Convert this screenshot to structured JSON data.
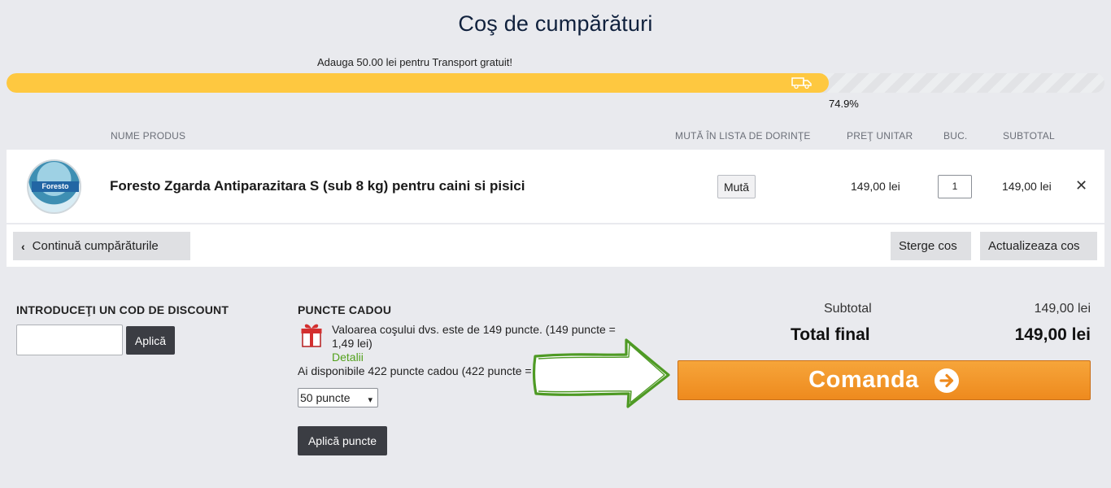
{
  "page": {
    "title": "Coş de cumpărături"
  },
  "shipping": {
    "message": "Adauga 50.00 lei pentru Transport gratuit!",
    "progress": 74.9,
    "progress_label": "74.9%",
    "icon": "truck-icon"
  },
  "table": {
    "headers": {
      "name": "NUME PRODUS",
      "move": "MUTĂ ÎN LISTA DE DORINŢE",
      "unit_price": "PREŢ UNITAR",
      "qty": "BUC.",
      "subtotal": "SUBTOTAL"
    },
    "items": [
      {
        "brand_badge": "Foresto",
        "name": "Foresto Zgarda Antiparazitara S (sub 8 kg) pentru caini si pisici",
        "move_label": "Mută",
        "unit_price": "149,00 lei",
        "qty": "1",
        "subtotal": "149,00 lei",
        "remove_icon": "close-icon"
      }
    ]
  },
  "actions": {
    "continue_label": "Continuă cumpărăturile",
    "clear_label": "Sterge cos",
    "update_label": "Actualizeaza cos"
  },
  "discount": {
    "heading": "INTRODUCEŢI UN COD DE DISCOUNT",
    "placeholder": "",
    "apply_label": "Aplică"
  },
  "points": {
    "heading": "PUNCTE CADOU",
    "cart_value_line1": "Valoarea coşului dvs. este de 149 puncte. (149 puncte =",
    "cart_value_line2": "1,49 lei)",
    "details_link": "Detalii",
    "available": "Ai disponibile 422 puncte cadou (422 puncte = 4",
    "selected_option": "50 puncte",
    "apply_label": "Aplică puncte",
    "icon": "gift-icon"
  },
  "summary": {
    "subtotal_label": "Subtotal",
    "subtotal_value": "149,00 lei",
    "total_label": "Total final",
    "total_value": "149,00 lei",
    "order_label": "Comanda"
  },
  "colors": {
    "accent_orange": "#f09227",
    "progress_yellow": "#fec840",
    "arrow_green": "#4e9a24",
    "link_green": "#52a11c"
  }
}
